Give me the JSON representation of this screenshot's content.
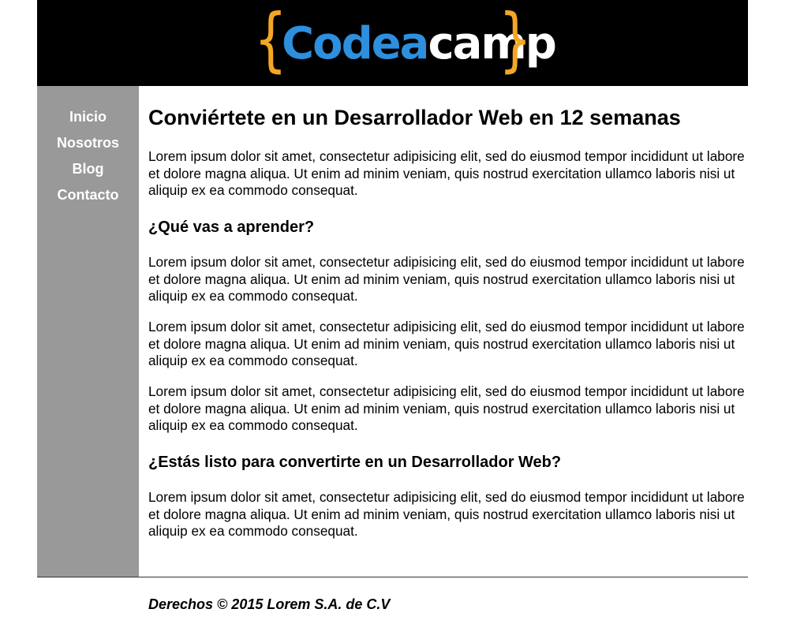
{
  "header": {
    "logo": {
      "brace_left": "{",
      "brace_right": "}",
      "word_part1": "Codea",
      "word_part2": "camp",
      "brace_color": "#f5a623",
      "word_part1_color": "#2d8fdd",
      "word_part2_color": "#ffffff"
    }
  },
  "nav": {
    "items": [
      {
        "label": "Inicio"
      },
      {
        "label": "Nosotros"
      },
      {
        "label": "Blog"
      },
      {
        "label": "Contacto"
      }
    ]
  },
  "main": {
    "title": "Conviértete en un Desarrollador Web en 12 semanas",
    "intro": "Lorem ipsum dolor sit amet, consectetur adipisicing elit, sed do eiusmod tempor incididunt ut labore et dolore magna aliqua. Ut enim ad minim veniam, quis nostrud exercitation ullamco laboris nisi ut aliquip ex ea commodo consequat.",
    "section1": {
      "heading": "¿Qué vas a aprender?",
      "paragraphs": [
        "Lorem ipsum dolor sit amet, consectetur adipisicing elit, sed do eiusmod tempor incididunt ut labore et dolore magna aliqua. Ut enim ad minim veniam, quis nostrud exercitation ullamco laboris nisi ut aliquip ex ea commodo consequat.",
        "Lorem ipsum dolor sit amet, consectetur adipisicing elit, sed do eiusmod tempor incididunt ut labore et dolore magna aliqua. Ut enim ad minim veniam, quis nostrud exercitation ullamco laboris nisi ut aliquip ex ea commodo consequat.",
        "Lorem ipsum dolor sit amet, consectetur adipisicing elit, sed do eiusmod tempor incididunt ut labore et dolore magna aliqua. Ut enim ad minim veniam, quis nostrud exercitation ullamco laboris nisi ut aliquip ex ea commodo consequat."
      ]
    },
    "section2": {
      "heading": "¿Estás listo para convertirte en un Desarrollador Web?",
      "paragraphs": [
        "Lorem ipsum dolor sit amet, consectetur adipisicing elit, sed do eiusmod tempor incididunt ut labore et dolore magna aliqua. Ut enim ad minim veniam, quis nostrud exercitation ullamco laboris nisi ut aliquip ex ea commodo consequat."
      ]
    }
  },
  "footer": {
    "text": "Derechos © 2015 Lorem S.A. de C.V"
  },
  "colors": {
    "header_bg": "#000000",
    "sidebar_bg": "#999999",
    "nav_text": "#ffffff"
  }
}
